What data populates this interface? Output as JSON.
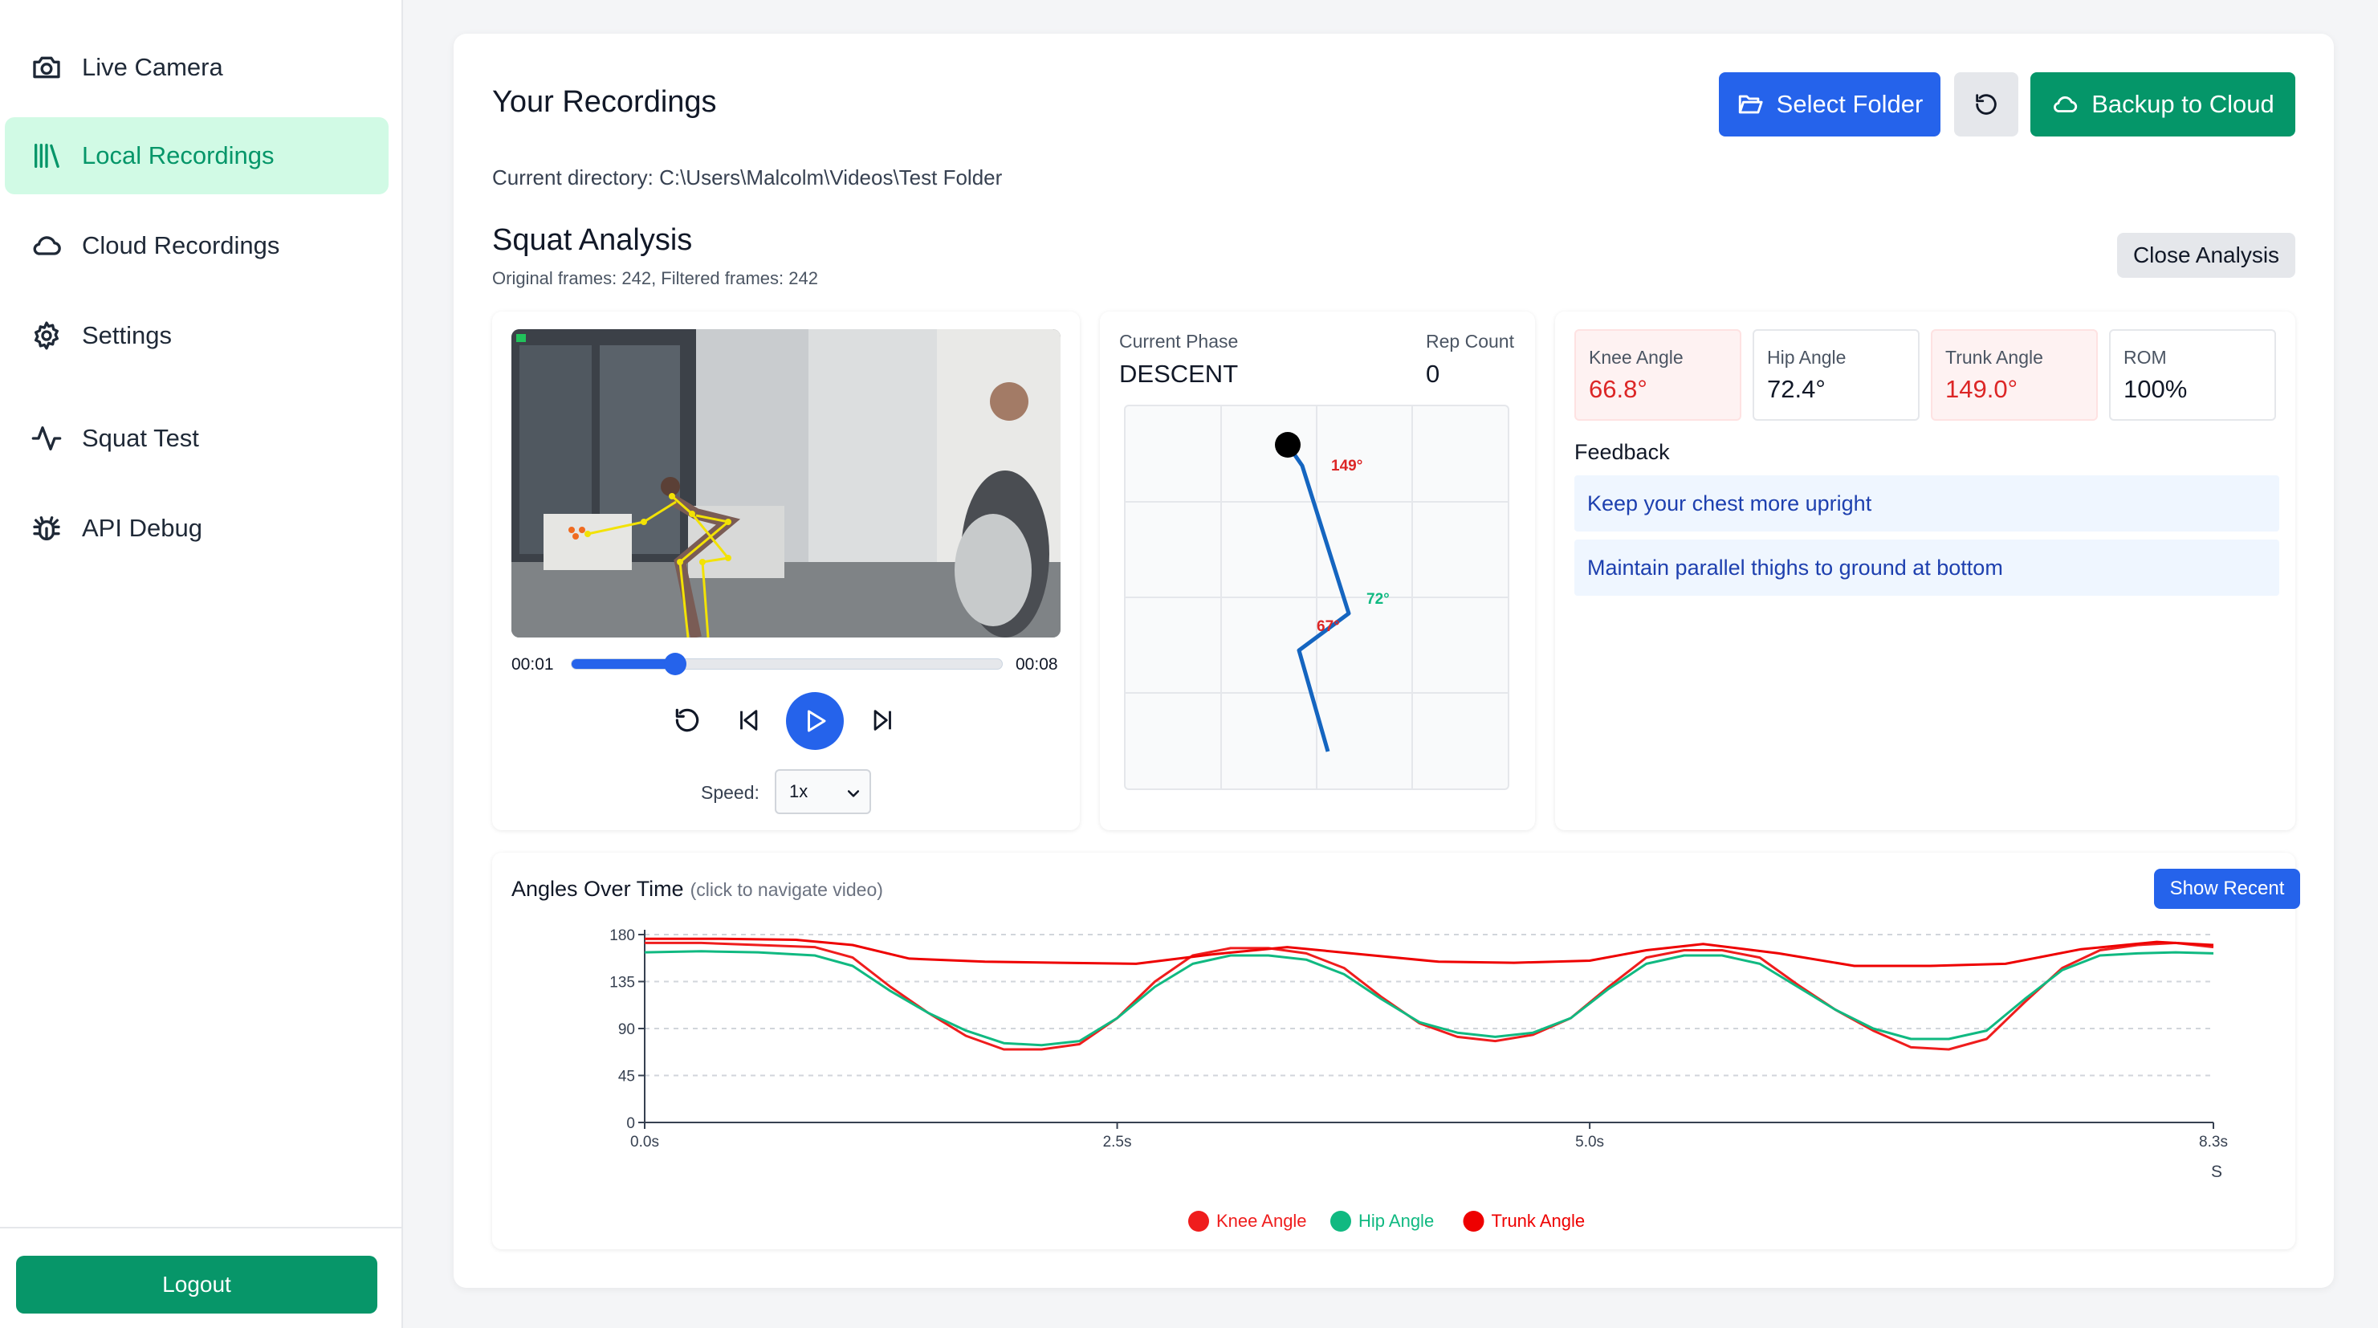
{
  "sidebar": {
    "items": [
      {
        "label": "Live Camera",
        "icon": "camera-icon"
      },
      {
        "label": "Local Recordings",
        "icon": "library-icon",
        "active": true
      },
      {
        "label": "Cloud Recordings",
        "icon": "cloud-icon"
      },
      {
        "label": "Settings",
        "icon": "gear-icon"
      },
      {
        "label": "Squat Test",
        "icon": "activity-icon"
      },
      {
        "label": "API Debug",
        "icon": "bug-icon"
      }
    ],
    "logout_label": "Logout"
  },
  "header": {
    "title": "Your Recordings",
    "select_folder_label": "Select Folder",
    "backup_label": "Backup to Cloud",
    "current_directory": "Current directory: C:\\Users\\Malcolm\\Videos\\Test Folder"
  },
  "analysis": {
    "title": "Squat Analysis",
    "subtitle": "Original frames: 242, Filtered frames: 242",
    "close_label": "Close Analysis"
  },
  "player": {
    "current_time": "00:01",
    "duration": "00:08",
    "progress": 0.24,
    "speed_label": "Speed:",
    "speed_value": "1x"
  },
  "phase": {
    "phase_label": "Current Phase",
    "phase_value": "DESCENT",
    "rep_label": "Rep Count",
    "rep_value": "0",
    "trunk_angle_text": "149°",
    "hip_angle_text": "72°",
    "knee_angle_text": "67°"
  },
  "metrics": [
    {
      "label": "Knee Angle",
      "value": "66.8°",
      "status": "bad"
    },
    {
      "label": "Hip Angle",
      "value": "72.4°",
      "status": "ok"
    },
    {
      "label": "Trunk Angle",
      "value": "149.0°",
      "status": "bad"
    },
    {
      "label": "ROM",
      "value": "100%",
      "status": "ok"
    }
  ],
  "feedback": {
    "title": "Feedback",
    "items": [
      "Keep your chest more upright",
      "Maintain parallel thighs to ground at bottom"
    ]
  },
  "chart_panel": {
    "title": "Angles Over Time",
    "hint": "(click to navigate video)",
    "show_recent_label": "Show Recent"
  },
  "colors": {
    "accent_green": "#059669",
    "accent_blue": "#2563eb",
    "knee": "#ef1d1d",
    "hip": "#10b981",
    "trunk": "#ee0000"
  },
  "chart_data": {
    "type": "line",
    "xlabel": "S",
    "ylabel": "",
    "xlim": [
      0,
      8.3
    ],
    "ylim": [
      0,
      180
    ],
    "x_ticks": [
      "0.0s",
      "2.5s",
      "5.0s",
      "8.3s"
    ],
    "x_tick_values": [
      0,
      2.5,
      5.0,
      8.3
    ],
    "y_ticks": [
      0,
      45,
      90,
      135,
      180
    ],
    "legend_position": "bottom",
    "series": [
      {
        "name": "Knee Angle",
        "color": "#ef1d1d",
        "x": [
          0,
          0.3,
          0.6,
          0.9,
          1.1,
          1.3,
          1.5,
          1.7,
          1.9,
          2.1,
          2.3,
          2.5,
          2.7,
          2.9,
          3.1,
          3.3,
          3.5,
          3.7,
          3.9,
          4.1,
          4.3,
          4.5,
          4.7,
          4.9,
          5.1,
          5.3,
          5.5,
          5.7,
          5.9,
          6.1,
          6.3,
          6.5,
          6.7,
          6.9,
          7.1,
          7.3,
          7.5,
          7.7,
          7.9,
          8.1,
          8.3
        ],
        "y": [
          172,
          172,
          170,
          168,
          158,
          130,
          105,
          83,
          70,
          70,
          75,
          100,
          135,
          160,
          167,
          167,
          162,
          148,
          120,
          95,
          82,
          78,
          84,
          100,
          130,
          158,
          165,
          165,
          158,
          132,
          108,
          88,
          72,
          70,
          80,
          115,
          148,
          165,
          170,
          172,
          168
        ]
      },
      {
        "name": "Hip Angle",
        "color": "#10b981",
        "x": [
          0,
          0.3,
          0.6,
          0.9,
          1.1,
          1.3,
          1.5,
          1.7,
          1.9,
          2.1,
          2.3,
          2.5,
          2.7,
          2.9,
          3.1,
          3.3,
          3.5,
          3.7,
          3.9,
          4.1,
          4.3,
          4.5,
          4.7,
          4.9,
          5.1,
          5.3,
          5.5,
          5.7,
          5.9,
          6.1,
          6.3,
          6.5,
          6.7,
          6.9,
          7.1,
          7.3,
          7.5,
          7.7,
          7.9,
          8.1,
          8.3
        ],
        "y": [
          163,
          164,
          163,
          160,
          150,
          126,
          105,
          88,
          76,
          74,
          78,
          100,
          130,
          152,
          160,
          160,
          156,
          142,
          118,
          96,
          86,
          82,
          86,
          100,
          128,
          152,
          160,
          160,
          152,
          130,
          108,
          90,
          80,
          80,
          88,
          118,
          146,
          160,
          162,
          163,
          162
        ]
      },
      {
        "name": "Trunk Angle",
        "color": "#ee0000",
        "x": [
          0,
          0.4,
          0.8,
          1.1,
          1.4,
          1.8,
          2.2,
          2.6,
          3.0,
          3.4,
          3.8,
          4.2,
          4.6,
          5.0,
          5.3,
          5.6,
          6.0,
          6.4,
          6.8,
          7.2,
          7.6,
          8.0,
          8.3
        ],
        "y": [
          176,
          176,
          175,
          170,
          157,
          154,
          153,
          152,
          161,
          168,
          161,
          154,
          153,
          155,
          165,
          171,
          162,
          150,
          150,
          152,
          166,
          173,
          170
        ]
      }
    ]
  }
}
